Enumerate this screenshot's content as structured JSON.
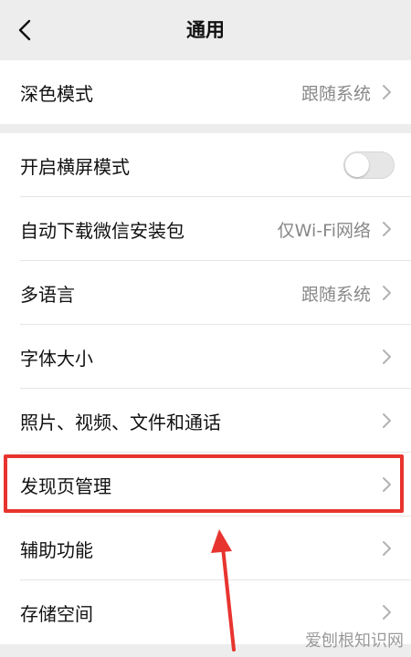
{
  "nav": {
    "title": "通用",
    "back_icon": "chevron-left-icon"
  },
  "colors": {
    "background": "#ededed",
    "card": "#ffffff",
    "highlight": "#e8342f",
    "secondary_text": "#888888"
  },
  "group1": {
    "dark_mode": {
      "label": "深色模式",
      "value": "跟随系统"
    }
  },
  "group2": {
    "landscape": {
      "label": "开启横屏模式",
      "enabled": false
    },
    "auto_download": {
      "label": "自动下载微信安装包",
      "value": "仅Wi-Fi网络"
    },
    "language": {
      "label": "多语言",
      "value": "跟随系统"
    },
    "font_size": {
      "label": "字体大小"
    },
    "media": {
      "label": "照片、视频、文件和通话"
    },
    "discover": {
      "label": "发现页管理",
      "highlighted": true
    },
    "accessibility": {
      "label": "辅助功能"
    },
    "storage": {
      "label": "存储空间"
    }
  },
  "watermark": "爱刨根知识网"
}
